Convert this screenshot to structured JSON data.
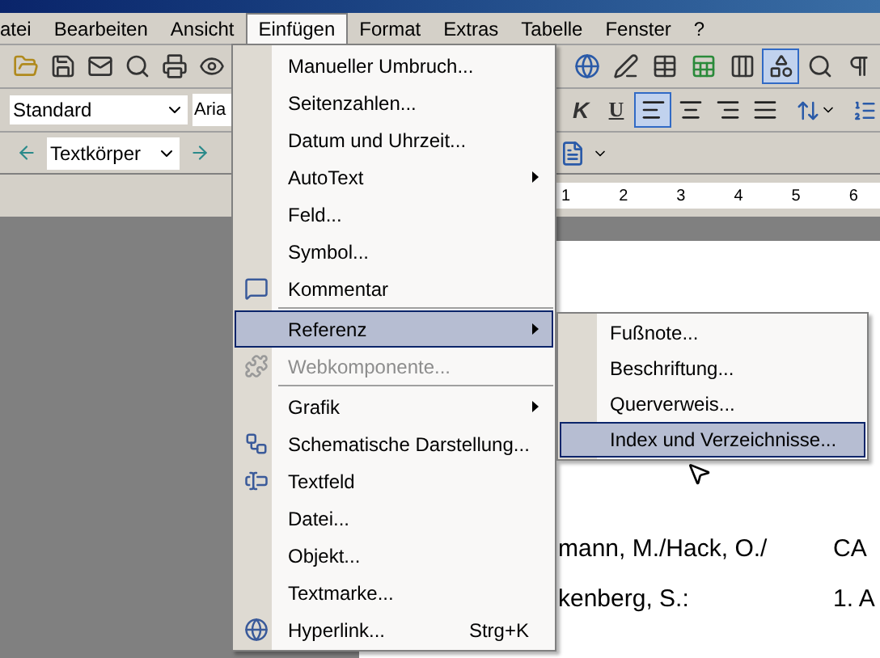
{
  "menubar": [
    {
      "label": "atei",
      "selected": false
    },
    {
      "label": "Bearbeiten",
      "selected": false
    },
    {
      "label": "Ansicht",
      "selected": false
    },
    {
      "label": "Einfügen",
      "selected": true
    },
    {
      "label": "Format",
      "selected": false
    },
    {
      "label": "Extras",
      "selected": false
    },
    {
      "label": "Tabelle",
      "selected": false
    },
    {
      "label": "Fenster",
      "selected": false
    },
    {
      "label": "?",
      "selected": false
    }
  ],
  "standard_toolbar": {
    "left_buttons": [
      {
        "pressed": false
      },
      {
        "pressed": false
      },
      {
        "pressed": false
      },
      {
        "pressed": false
      },
      {
        "pressed": false
      },
      {
        "pressed": false
      }
    ],
    "right_buttons": [
      {
        "pressed": false
      },
      {
        "pressed": false
      },
      {
        "pressed": false
      },
      {
        "pressed": false
      },
      {
        "pressed": false
      },
      {
        "pressed": true
      },
      {
        "pressed": false
      },
      {
        "pressed": false
      }
    ]
  },
  "formatting_toolbar": {
    "style": "Standard",
    "font": "Aria",
    "italic": "K",
    "underline": "U",
    "alignments": [
      {
        "selected": true
      },
      {
        "selected": false
      },
      {
        "selected": false
      },
      {
        "selected": false
      }
    ]
  },
  "outline_toolbar": {
    "style": "Textkörper"
  },
  "ruler": {
    "numbers": [
      "1",
      "2",
      "3",
      "4",
      "5",
      "6"
    ]
  },
  "document": {
    "lines": [
      {
        "left": "mann, M./Hack, O./",
        "right": "CA"
      },
      {
        "left": "kenberg, S.:",
        "right": "1. A"
      }
    ]
  },
  "menu": {
    "items": [
      {
        "kind": "item",
        "label": "Manueller Umbruch...",
        "submenu": false,
        "disabled": false,
        "selected": false
      },
      {
        "kind": "item",
        "label": "Seitenzahlen...",
        "submenu": false,
        "disabled": false,
        "selected": false
      },
      {
        "kind": "item",
        "label": "Datum und Uhrzeit...",
        "submenu": false,
        "disabled": false,
        "selected": false
      },
      {
        "kind": "item",
        "label": "AutoText",
        "submenu": true,
        "disabled": false,
        "selected": false
      },
      {
        "kind": "item",
        "label": "Feld...",
        "submenu": false,
        "disabled": false,
        "selected": false
      },
      {
        "kind": "item",
        "label": "Symbol...",
        "submenu": false,
        "disabled": false,
        "selected": false
      },
      {
        "kind": "item",
        "label": "Kommentar",
        "submenu": false,
        "disabled": false,
        "selected": false
      },
      {
        "kind": "separator"
      },
      {
        "kind": "item",
        "label": "Referenz",
        "submenu": true,
        "disabled": false,
        "selected": true
      },
      {
        "kind": "item",
        "label": "Webkomponente...",
        "submenu": false,
        "disabled": true,
        "selected": false
      },
      {
        "kind": "separator"
      },
      {
        "kind": "item",
        "label": "Grafik",
        "submenu": true,
        "disabled": false,
        "selected": false
      },
      {
        "kind": "item",
        "label": "Schematische Darstellung...",
        "submenu": false,
        "disabled": false,
        "selected": false
      },
      {
        "kind": "item",
        "label": "Textfeld",
        "submenu": false,
        "disabled": false,
        "selected": false
      },
      {
        "kind": "item",
        "label": "Datei...",
        "submenu": false,
        "disabled": false,
        "selected": false
      },
      {
        "kind": "item",
        "label": "Objekt...",
        "submenu": false,
        "disabled": false,
        "selected": false
      },
      {
        "kind": "item",
        "label": "Textmarke...",
        "submenu": false,
        "disabled": false,
        "selected": false
      },
      {
        "kind": "item",
        "label": "Hyperlink...",
        "submenu": false,
        "disabled": false,
        "selected": false,
        "shortcut": "Strg+K"
      }
    ]
  },
  "submenu": {
    "items": [
      {
        "label": "Fußnote...",
        "selected": false
      },
      {
        "label": "Beschriftung...",
        "selected": false
      },
      {
        "label": "Querverweis...",
        "selected": false
      },
      {
        "label": "Index und Verzeichnisse...",
        "selected": true
      }
    ]
  }
}
